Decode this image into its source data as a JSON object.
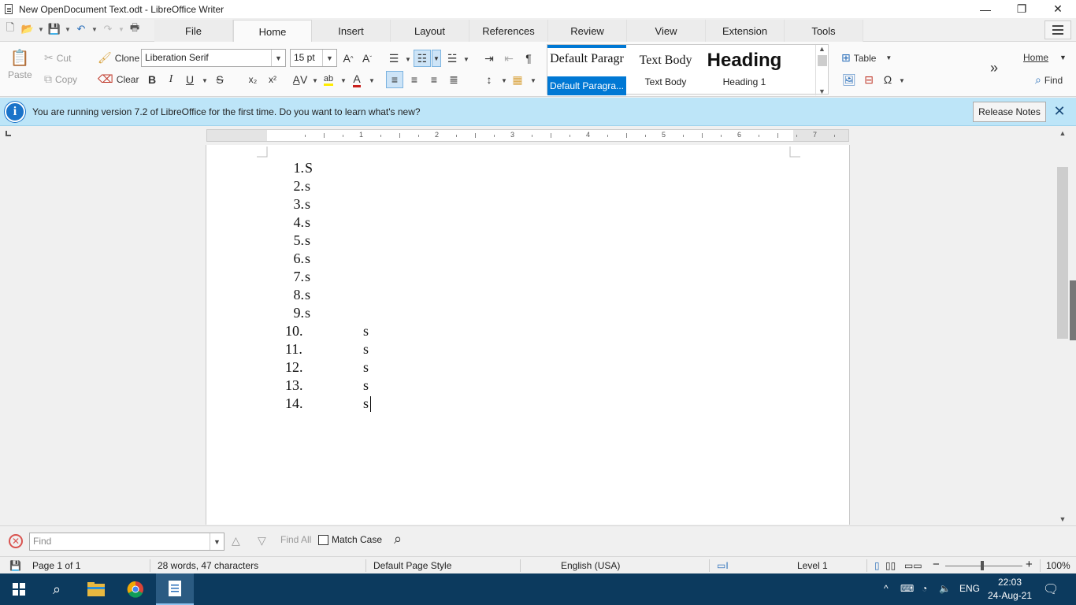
{
  "window": {
    "title": "New OpenDocument Text.odt - LibreOffice Writer",
    "controls": [
      "—",
      "❐",
      "✕"
    ]
  },
  "tabs": [
    {
      "label": "File",
      "active": false
    },
    {
      "label": "Home",
      "active": true
    },
    {
      "label": "Insert",
      "active": false
    },
    {
      "label": "Layout",
      "active": false
    },
    {
      "label": "References",
      "active": false
    },
    {
      "label": "Review",
      "active": false
    },
    {
      "label": "View",
      "active": false
    },
    {
      "label": "Extension",
      "active": false
    },
    {
      "label": "Tools",
      "active": false
    }
  ],
  "ribbon": {
    "paste": "Paste",
    "cut": "Cut",
    "copy": "Copy",
    "clone": "Clone",
    "clear": "Clear",
    "font_name": "Liberation Serif",
    "font_size": "15 pt",
    "bold": "B",
    "italic": "I",
    "underline": "U",
    "strike": "S",
    "subscript": "x₂",
    "superscript": "x²",
    "table": "Table",
    "home_dropdown": "Home",
    "find": "Find",
    "more": "»"
  },
  "styles": [
    {
      "preview": "Default Paragr",
      "label": "Default Paragra...",
      "selected": true
    },
    {
      "preview": "Text Body",
      "label": "Text Body",
      "selected": false
    },
    {
      "preview": "Heading",
      "label": "Heading 1",
      "selected": false
    }
  ],
  "infobar": {
    "message": "You are running version 7.2 of LibreOffice for the first time. Do you want to learn what's new?",
    "button": "Release Notes"
  },
  "ruler": {
    "numbers": [
      "1",
      "2",
      "3",
      "4",
      "5",
      "6",
      "7"
    ]
  },
  "document": {
    "items": [
      {
        "num": "1.",
        "text": "S"
      },
      {
        "num": "2.",
        "text": "s"
      },
      {
        "num": "3.",
        "text": "s"
      },
      {
        "num": "4.",
        "text": "s"
      },
      {
        "num": "5.",
        "text": "s"
      },
      {
        "num": "6.",
        "text": "s"
      },
      {
        "num": "7.",
        "text": "s"
      },
      {
        "num": "8.",
        "text": "s"
      },
      {
        "num": "9.",
        "text": "s"
      },
      {
        "num": "10.",
        "text": "s"
      },
      {
        "num": "11.",
        "text": "s"
      },
      {
        "num": "12.",
        "text": "s"
      },
      {
        "num": "13.",
        "text": "s"
      },
      {
        "num": "14.",
        "text": "s"
      }
    ]
  },
  "findbar": {
    "placeholder": "Find",
    "find_all": "Find All",
    "match_case": "Match Case"
  },
  "status": {
    "page": "Page 1 of 1",
    "words": "28 words, 47 characters",
    "page_style": "Default Page Style",
    "language": "English (USA)",
    "outline_level": "Level 1",
    "zoom": "100%"
  },
  "taskbar": {
    "lang": "ENG",
    "time": "22:03",
    "date": "24-Aug-21"
  },
  "colors": {
    "accent": "#0078d4",
    "infobar_bg": "#bde5f8",
    "taskbar_bg": "#0c3a5e"
  }
}
